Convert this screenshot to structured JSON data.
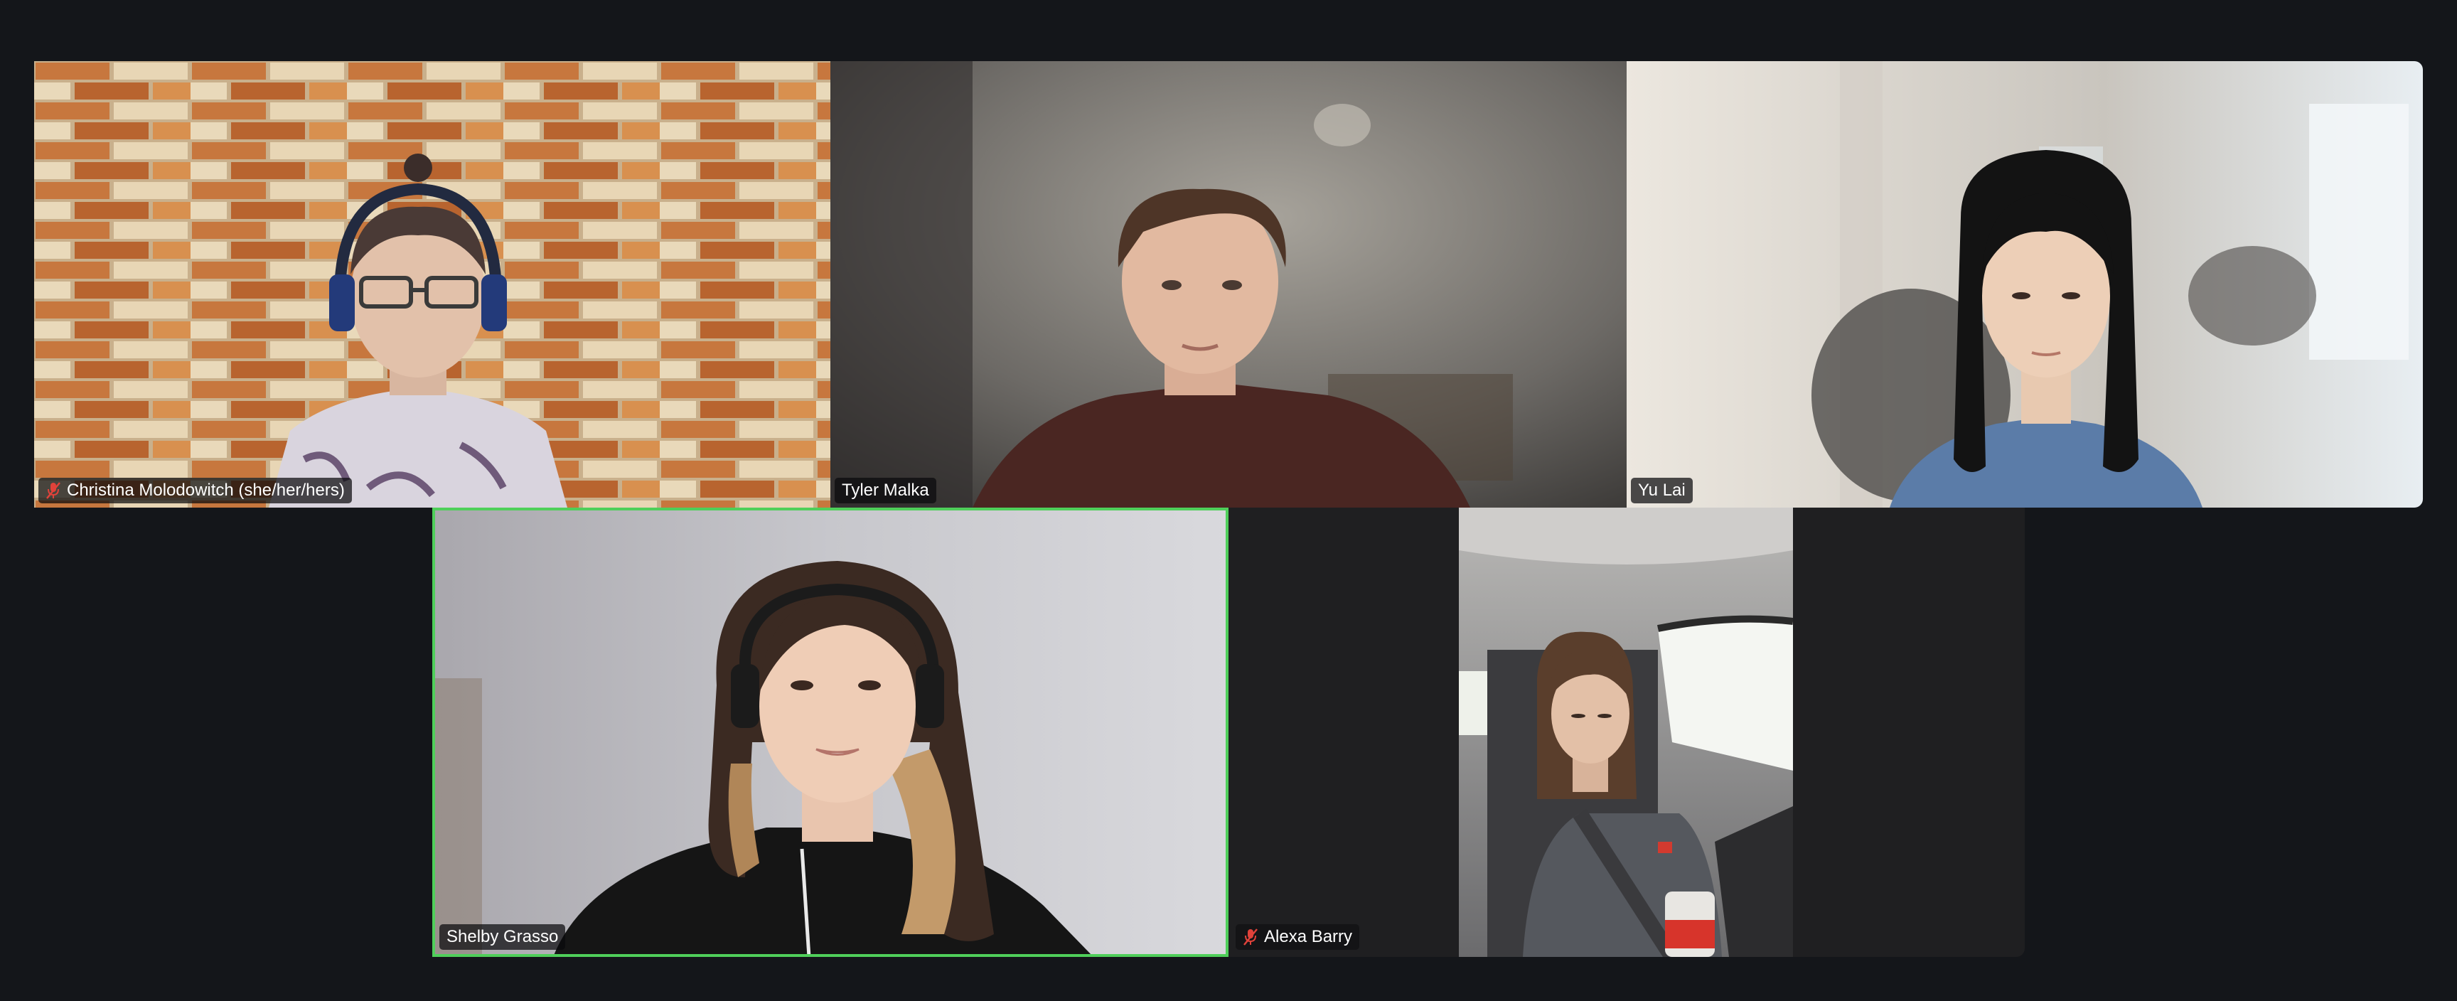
{
  "meeting": {
    "participants": [
      {
        "name": "Christina Molodowitch (she/her/hers)",
        "muted": true,
        "active_speaker": false
      },
      {
        "name": "Tyler Malka",
        "muted": false,
        "active_speaker": false
      },
      {
        "name": "Yu Lai",
        "muted": false,
        "active_speaker": false
      },
      {
        "name": "Shelby Grasso",
        "muted": false,
        "active_speaker": true
      },
      {
        "name": "Alexa Barry",
        "muted": true,
        "active_speaker": false
      }
    ],
    "icons": {
      "muted": "microphone-muted-icon"
    },
    "colors": {
      "background": "#14161a",
      "active_speaker_border": "#4fcf5a",
      "muted_icon": "#e0423a"
    }
  }
}
